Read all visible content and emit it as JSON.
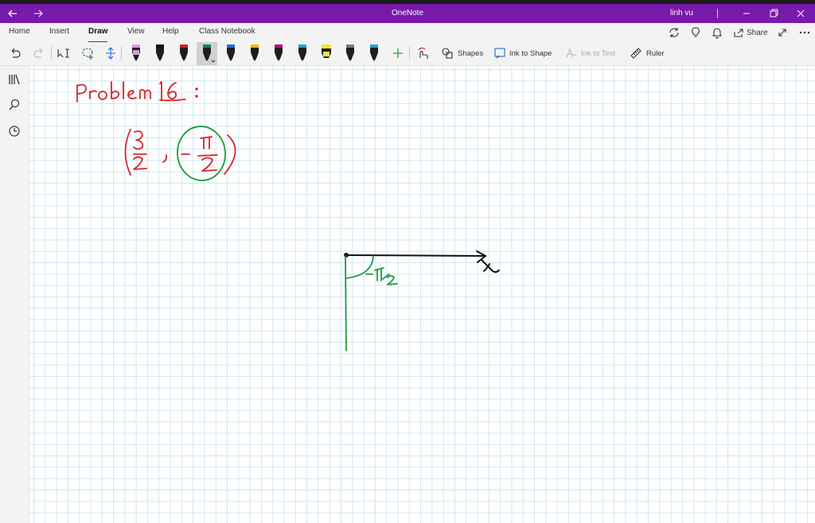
{
  "titlebar": {
    "back_icon": "back-arrow-icon",
    "forward_icon": "forward-arrow-icon",
    "title": "OneNote",
    "user": "linh vu",
    "minimize_icon": "minimize-icon",
    "restore_icon": "restore-icon",
    "close_icon": "close-icon",
    "color": "#7719aa"
  },
  "ribbon": {
    "tabs": [
      {
        "label": "Home"
      },
      {
        "label": "Insert"
      },
      {
        "label": "Draw"
      },
      {
        "label": "View"
      },
      {
        "label": "Help"
      },
      {
        "label": "Class Notebook"
      }
    ],
    "active_tab": "Draw",
    "share_label": "Share",
    "tools": {
      "shapes_label": "Shapes",
      "ink_to_shape_label": "Ink to Shape",
      "ink_to_text_label": "Ink to Text",
      "ruler_label": "Ruler"
    },
    "pens": [
      {
        "color": "#d59bd6"
      },
      {
        "color": "#111111"
      },
      {
        "color": "#cf2020"
      },
      {
        "color": "#0b8a3a"
      },
      {
        "color": "#1a6fd1"
      },
      {
        "color": "#f3b500"
      },
      {
        "color": "#b0127a"
      },
      {
        "color": "#18a4d8"
      },
      {
        "color": "#f7e53a"
      },
      {
        "color": "#7d7d7d"
      },
      {
        "color": "#2d9bd6"
      }
    ]
  },
  "sidebar": {
    "items": [
      "notebooks-icon",
      "search-icon",
      "recent-icon"
    ]
  },
  "ink_colors": {
    "red": "#d8262e",
    "green": "#1a9a3e",
    "black": "#111111"
  }
}
